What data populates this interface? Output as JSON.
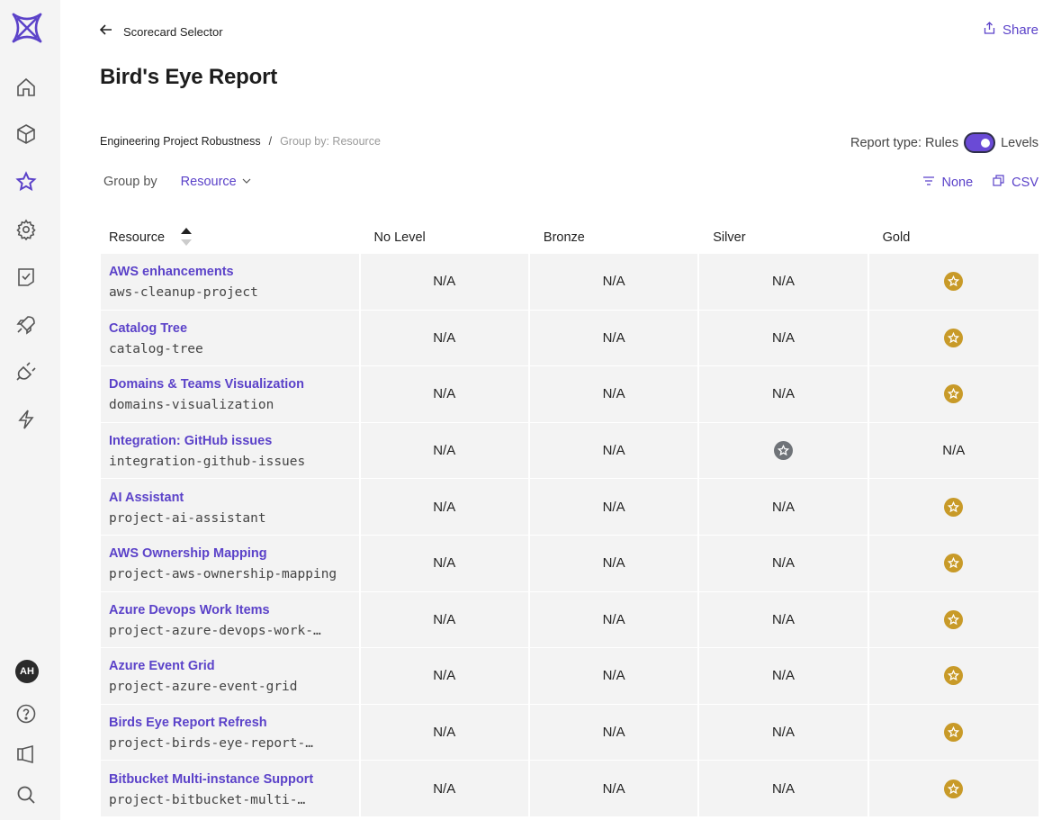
{
  "header": {
    "back_label": "Scorecard Selector",
    "share_label": "Share",
    "title": "Bird's Eye Report"
  },
  "breadcrumb": {
    "scorecard": "Engineering Project Robustness",
    "separator": "/",
    "group": "Group by: Resource"
  },
  "report_type": {
    "label": "Report type: Rules",
    "right_label": "Levels",
    "toggle_on": true
  },
  "group_by": {
    "label": "Group by",
    "value": "Resource"
  },
  "actions": {
    "filter_label": "None",
    "csv_label": "CSV"
  },
  "user": {
    "initials": "AH"
  },
  "table": {
    "columns": [
      "Resource",
      "No Level",
      "Bronze",
      "Silver",
      "Gold"
    ],
    "rows": [
      {
        "name": "AWS enhancements",
        "tag": "aws-cleanup-project",
        "cells": [
          "N/A",
          "N/A",
          "N/A",
          "gold-star"
        ]
      },
      {
        "name": "Catalog Tree",
        "tag": "catalog-tree",
        "cells": [
          "N/A",
          "N/A",
          "N/A",
          "gold-star"
        ]
      },
      {
        "name": "Domains & Teams Visualization",
        "tag": "domains-visualization",
        "cells": [
          "N/A",
          "N/A",
          "N/A",
          "gold-star"
        ]
      },
      {
        "name": "Integration: GitHub issues",
        "tag": "integration-github-issues",
        "cells": [
          "N/A",
          "N/A",
          "silver-star",
          "N/A"
        ]
      },
      {
        "name": "AI Assistant",
        "tag": "project-ai-assistant",
        "cells": [
          "N/A",
          "N/A",
          "N/A",
          "gold-star"
        ]
      },
      {
        "name": "AWS Ownership Mapping",
        "tag": "project-aws-ownership-mapping",
        "cells": [
          "N/A",
          "N/A",
          "N/A",
          "gold-star"
        ]
      },
      {
        "name": "Azure Devops Work Items",
        "tag": "project-azure-devops-work-…",
        "cells": [
          "N/A",
          "N/A",
          "N/A",
          "gold-star"
        ]
      },
      {
        "name": "Azure Event Grid",
        "tag": "project-azure-event-grid",
        "cells": [
          "N/A",
          "N/A",
          "N/A",
          "gold-star"
        ]
      },
      {
        "name": "Birds Eye Report Refresh",
        "tag": "project-birds-eye-report-…",
        "cells": [
          "N/A",
          "N/A",
          "N/A",
          "gold-star"
        ]
      },
      {
        "name": "Bitbucket Multi-instance Support",
        "tag": "project-bitbucket-multi-…",
        "cells": [
          "N/A",
          "N/A",
          "N/A",
          "gold-star"
        ]
      }
    ]
  },
  "colors": {
    "accent": "#5b42c9",
    "gold": "#c89a28",
    "silver": "#6f7378"
  }
}
